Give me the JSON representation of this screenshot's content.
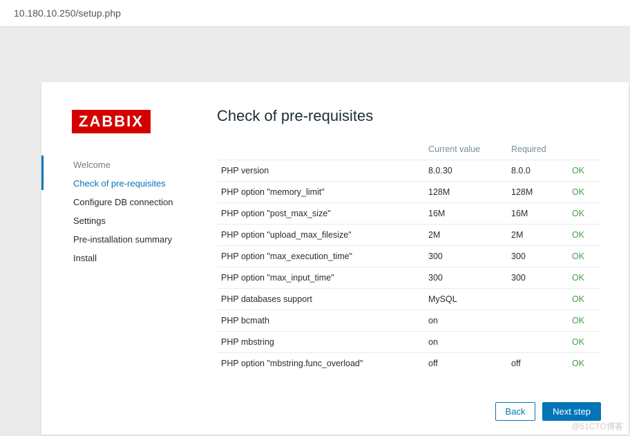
{
  "url": "10.180.10.250/setup.php",
  "logo_text": "ZABBIX",
  "page_title": "Check of pre-requisites",
  "steps": [
    {
      "label": "Welcome",
      "state": "done"
    },
    {
      "label": "Check of pre-requisites",
      "state": "current"
    },
    {
      "label": "Configure DB connection",
      "state": "pending"
    },
    {
      "label": "Settings",
      "state": "pending"
    },
    {
      "label": "Pre-installation summary",
      "state": "pending"
    },
    {
      "label": "Install",
      "state": "pending"
    }
  ],
  "table": {
    "headers": {
      "name": "",
      "current": "Current value",
      "required": "Required",
      "status": ""
    },
    "rows": [
      {
        "name": "PHP version",
        "current": "8.0.30",
        "required": "8.0.0",
        "status": "OK"
      },
      {
        "name": "PHP option \"memory_limit\"",
        "current": "128M",
        "required": "128M",
        "status": "OK"
      },
      {
        "name": "PHP option \"post_max_size\"",
        "current": "16M",
        "required": "16M",
        "status": "OK"
      },
      {
        "name": "PHP option \"upload_max_filesize\"",
        "current": "2M",
        "required": "2M",
        "status": "OK"
      },
      {
        "name": "PHP option \"max_execution_time\"",
        "current": "300",
        "required": "300",
        "status": "OK"
      },
      {
        "name": "PHP option \"max_input_time\"",
        "current": "300",
        "required": "300",
        "status": "OK"
      },
      {
        "name": "PHP databases support",
        "current": "MySQL",
        "required": "",
        "status": "OK"
      },
      {
        "name": "PHP bcmath",
        "current": "on",
        "required": "",
        "status": "OK"
      },
      {
        "name": "PHP mbstring",
        "current": "on",
        "required": "",
        "status": "OK"
      },
      {
        "name": "PHP option \"mbstring.func_overload\"",
        "current": "off",
        "required": "off",
        "status": "OK"
      }
    ]
  },
  "buttons": {
    "back": "Back",
    "next": "Next step"
  },
  "watermark": "@51CTO博客"
}
